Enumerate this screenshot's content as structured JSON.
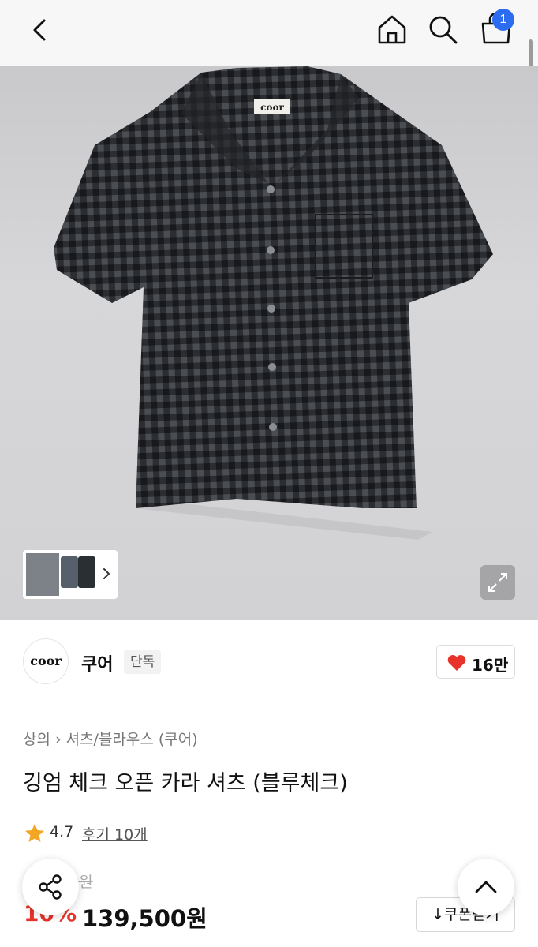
{
  "nav": {
    "icons": [
      "back-icon",
      "home-icon",
      "search-icon",
      "cart-icon"
    ],
    "cart_count": "1"
  },
  "product_image": {
    "label_text": "coor"
  },
  "brand": {
    "logo_text": "coor",
    "name": "쿠어",
    "tag": "단독",
    "likes": "16만",
    "heart_color": "#e8322a"
  },
  "breadcrumb": {
    "items": [
      "상의",
      "셔츠/블라우스 (쿠어)"
    ]
  },
  "product": {
    "title": "깅엄 체크 오픈 카라 셔츠 (블루체크)",
    "rating": "4.7",
    "reviews": "후기 10개",
    "original_price": "0원",
    "discount": "10%",
    "price": "139,500원"
  },
  "actions": {
    "coupon_label": "쿠폰받기"
  },
  "colors": {
    "accent_red": "#e8322a",
    "badge_blue": "#2b6cf0",
    "star": "#f2a623"
  }
}
